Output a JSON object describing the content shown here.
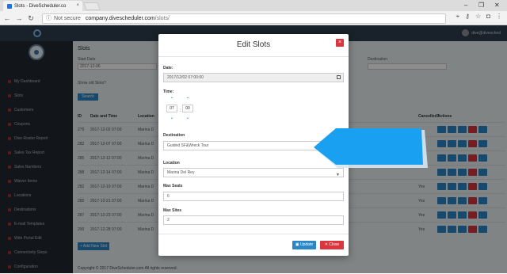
{
  "browser": {
    "tab_title": "Slots - DiveScheduler.co",
    "tab_close": "×",
    "not_secure": "Not secure",
    "url_domain": "company.divescheduler.com",
    "url_path": "/slots/",
    "win_min": "‒",
    "win_max": "❐",
    "win_close": "✕"
  },
  "app": {
    "user_name": "dive@divesched",
    "page_title": "Slots",
    "filter_start_label": "Start Date",
    "filter_start_value": "2017-12-06",
    "filter_dest_label": "Destination",
    "show_old_slots": "Show old Slots?",
    "search_button": "Search",
    "add_button": "+ Add New Slot",
    "footer": "Copyright © 2017 DiveScheduler.com All rights reserved.",
    "table": {
      "headers": [
        "ID",
        "Date and Time",
        "Location",
        "Next Divers",
        "Cancelled?",
        "Actions"
      ],
      "rows": [
        {
          "id": "279",
          "datetime": "2017-12-02 07:00",
          "location": "Marina D",
          "cancelled": ""
        },
        {
          "id": "282",
          "datetime": "2017-12-07 07:00",
          "location": "Marina D",
          "cancelled": ""
        },
        {
          "id": "285",
          "datetime": "2017-12-12 07:00",
          "location": "Marina D",
          "cancelled": ""
        },
        {
          "id": "288",
          "datetime": "2017-12-14 07:00",
          "location": "Marina D",
          "cancelled": ""
        },
        {
          "id": "282",
          "datetime": "2017-12-19 07:00",
          "location": "Marina D",
          "cancelled": "Yes"
        },
        {
          "id": "285",
          "datetime": "2017-12-21 07:00",
          "location": "Marina D",
          "cancelled": "Yes"
        },
        {
          "id": "287",
          "datetime": "2017-12-23 07:00",
          "location": "Marina D",
          "cancelled": "Yes"
        },
        {
          "id": "290",
          "datetime": "2017-12-28 07:00",
          "location": "Marina D",
          "cancelled": "Yes"
        }
      ]
    }
  },
  "sidebar": {
    "items": [
      {
        "label": "My Dashboard"
      },
      {
        "label": "Slots"
      },
      {
        "label": "Customers"
      },
      {
        "label": "Coupons"
      },
      {
        "label": "Dive Roster Report"
      },
      {
        "label": "Sales Tax Report"
      },
      {
        "label": "Sales Numbers"
      },
      {
        "label": "Waiver Items"
      },
      {
        "label": "Locations"
      },
      {
        "label": "Destinations"
      },
      {
        "label": "E-mail Templates"
      },
      {
        "label": "Web Portal Edit"
      },
      {
        "label": "Connectivity Steps"
      },
      {
        "label": "Configuration"
      }
    ]
  },
  "modal": {
    "title": "Edit Slots",
    "close_icon": "×",
    "date_label": "Date:",
    "date_value": "2017/12/02 07:00:00",
    "time_label": "Time:",
    "time_hour": "07",
    "time_minute": "00",
    "time_sep": ":",
    "destination_label": "Destination",
    "destination_value": "Guided SF&Wreck Tour",
    "location_label": "Location",
    "location_value": "Marina Del Rey",
    "max_seats_label": "Max Seats",
    "max_seats_value": "6",
    "max_sites_label": "Max Sites",
    "max_sites_value": "2",
    "update_button": "Update",
    "close_button": "Close"
  },
  "colors": {
    "primary": "#2a86c5",
    "danger": "#d9363e",
    "sidebar": "#22272e",
    "pointer": "#1aa0f0"
  }
}
